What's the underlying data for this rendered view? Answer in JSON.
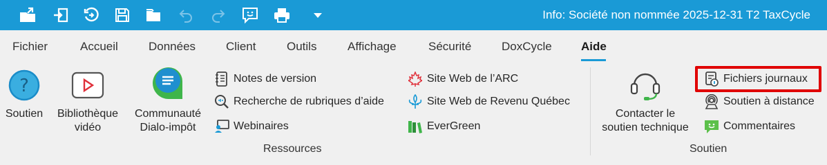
{
  "window": {
    "title": "Info: Société non nommée 2025-12-31 T2 TaxCycle",
    "accent": "#1a9ad6"
  },
  "quick_access": [
    {
      "icon": "open-folder-icon"
    },
    {
      "icon": "import-icon"
    },
    {
      "icon": "refresh-icon"
    },
    {
      "icon": "save-icon"
    },
    {
      "icon": "folder-icon"
    },
    {
      "icon": "undo-icon"
    },
    {
      "icon": "redo-icon"
    },
    {
      "icon": "feedback-icon"
    },
    {
      "icon": "print-icon"
    },
    {
      "icon": "customize-dropdown-icon"
    }
  ],
  "tabs": [
    "Fichier",
    "Accueil",
    "Données",
    "Client",
    "Outils",
    "Affichage",
    "Sécurité",
    "DoxCycle",
    "Aide"
  ],
  "active_tab": "Aide",
  "ribbon": {
    "soutien_btn": "Soutien",
    "video_line1": "Bibliothèque",
    "video_line2": "vidéo",
    "community_line1": "Communauté",
    "community_line2": "Dialo-impôt",
    "notes": "Notes de version",
    "search_help": "Recherche de rubriques d’aide",
    "webinars": "Webinaires",
    "cra_site": "Site Web de l’ARC",
    "rq_site": "Site Web de Revenu Québec",
    "evergreen": "EverGreen",
    "ressources_label": "Ressources",
    "contact_line1": "Contacter le",
    "contact_line2": "soutien technique",
    "log_files": "Fichiers journaux",
    "remote_support": "Soutien à distance",
    "comments": "Commentaires",
    "soutien_label": "Soutien"
  },
  "highlight_color": "#e00000"
}
